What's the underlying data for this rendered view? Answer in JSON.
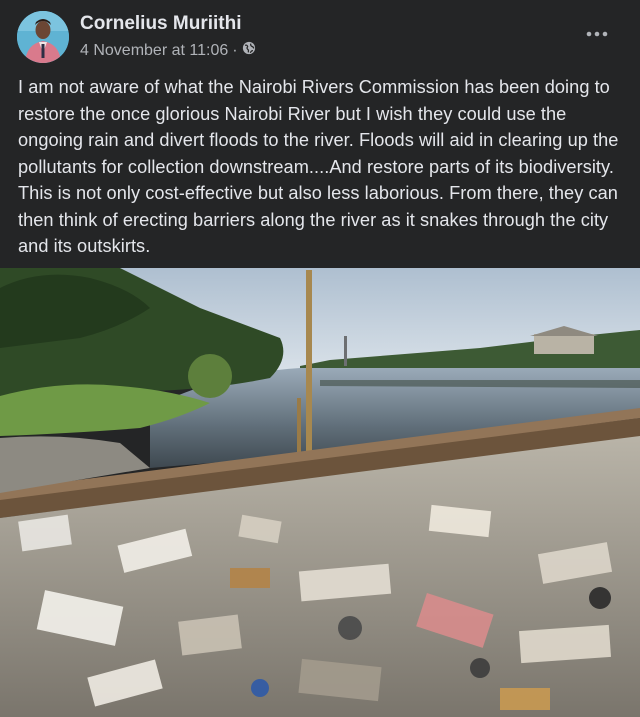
{
  "post": {
    "author": "Cornelius Muriithi",
    "timestamp": "4 November at 11:06",
    "separator": "·",
    "privacy_icon": "globe-icon",
    "more_icon": "more-horizontal-icon",
    "text": "I am not aware of what the Nairobi Rivers Commission has been doing to restore the once glorious Nairobi River but I wish they could use the ongoing rain and divert floods to the river. Floods will aid in clearing up the pollutants for collection downstream....And restore parts of its biodiversity. This is not only cost-effective but also less laborious. From there, they can then think of erecting barriers along the river as it snakes through the city and its outskirts."
  },
  "colors": {
    "background": "#242526",
    "primary_text": "#e4e6eb",
    "secondary_text": "#b0b3b8"
  }
}
